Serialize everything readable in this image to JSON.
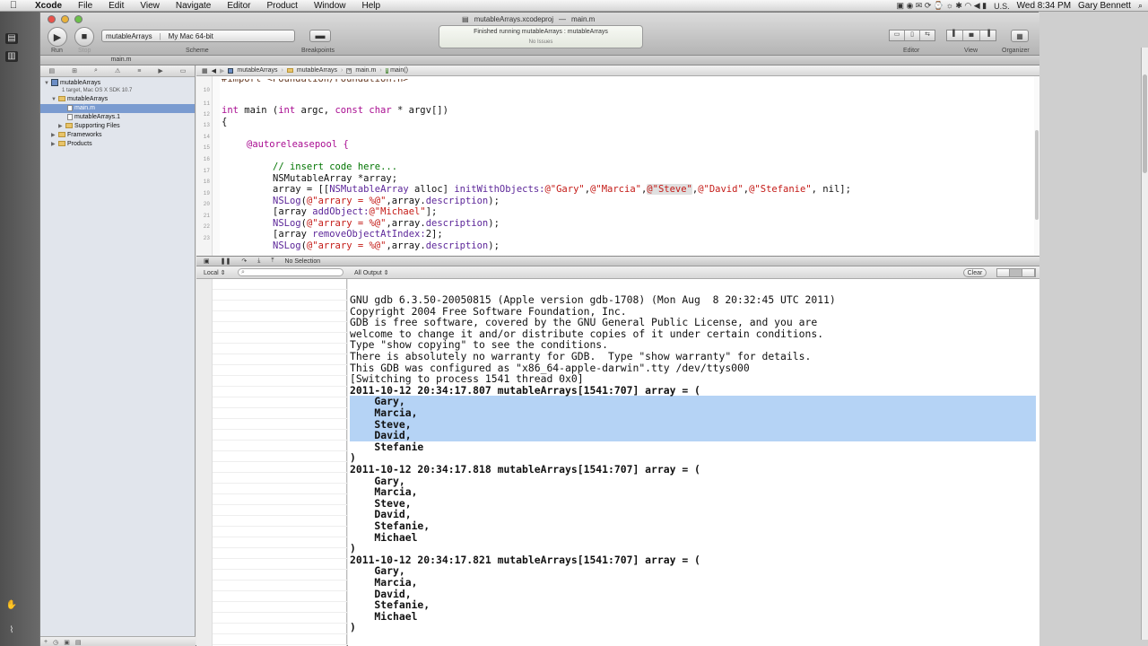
{
  "menubar": {
    "app": "Xcode",
    "items": [
      "File",
      "Edit",
      "View",
      "Navigate",
      "Editor",
      "Product",
      "Window",
      "Help"
    ],
    "locale": "U.S.",
    "clock": "Wed 8:34 PM",
    "user": "Gary Bennett"
  },
  "window": {
    "title_project": "mutableArrays.xcodeproj",
    "title_file": "main.m",
    "dash": "—"
  },
  "toolbar": {
    "run_label": "Run",
    "stop_label": "Stop",
    "scheme_name": "mutableArrays",
    "scheme_destination": "My Mac 64-bit",
    "scheme_label": "Scheme",
    "breakpoints_label": "Breakpoints",
    "activity_line1": "Finished running mutableArrays : mutableArrays",
    "activity_line2": "No Issues",
    "editor_label": "Editor",
    "view_label": "View",
    "organizer_label": "Organizer"
  },
  "tab": {
    "label": "main.m"
  },
  "navigator": {
    "project_name": "mutableArrays",
    "project_sub": "1 target, Mac OS X SDK 10.7",
    "group_name": "mutableArrays",
    "files": [
      "main.m",
      "mutableArrays.1"
    ],
    "supporting": "Supporting Files",
    "frameworks": "Frameworks",
    "products": "Products"
  },
  "jumpbar": {
    "crumbs": [
      "mutableArrays",
      "mutableArrays",
      "main.m",
      "main()"
    ]
  },
  "editor": {
    "line_numbers": [
      "10",
      "11",
      "12",
      "13",
      "14",
      "15",
      "16",
      "17",
      "18",
      "19",
      "20",
      "21",
      "22",
      "23"
    ],
    "code": {
      "import_partial": "#import <Foundation/Foundation.h>",
      "l11_a": "int",
      "l11_b": " main (",
      "l11_c": "int",
      "l11_d": " argc, ",
      "l11_e": "const",
      "l11_f": " ",
      "l11_g": "char",
      "l11_h": " * argv[])",
      "l12": "{",
      "l14": "@autoreleasepool {",
      "l16": "// insert code here...",
      "l17": "NSMutableArray *array;",
      "l18_a": "array = [[",
      "l18_b": "NSMutableArray",
      "l18_c": " alloc] ",
      "l18_d": "initWithObjects:",
      "l18_e": "@\"Gary\"",
      "l18_f": ",",
      "l18_g": "@\"Marcia\"",
      "l18_h": ",",
      "l18_i": "@\"Steve\"",
      "l18_j": ",",
      "l18_k": "@\"David\"",
      "l18_l": ",",
      "l18_m": "@\"Stefanie\"",
      "l18_n": ", nil];",
      "l19_a": "NSLog",
      "l19_b": "(",
      "l19_c": "@\"arrary = %@\"",
      "l19_d": ",array.",
      "l19_e": "description",
      "l19_f": ");",
      "l20_a": "[array ",
      "l20_b": "addObject:",
      "l20_c": "@\"Michael\"",
      "l20_d": "];",
      "l21_a": "NSLog",
      "l21_b": "(",
      "l21_c": "@\"arrary = %@\"",
      "l21_d": ",array.",
      "l21_e": "description",
      "l21_f": ");",
      "l22_a": "[array ",
      "l22_b": "removeObjectAtIndex:",
      "l22_c": "2];",
      "l23_a": "NSLog",
      "l23_b": "(",
      "l23_c": "@\"arrary = %@\"",
      "l23_d": ",array.",
      "l23_e": "description",
      "l23_f": ");"
    }
  },
  "debugbar": {
    "selection": "No Selection"
  },
  "filterbar": {
    "locals": "Local ⇕",
    "output": "All Output ⇕",
    "clear": "Clear"
  },
  "console": {
    "lines": [
      "GNU gdb 6.3.50-20050815 (Apple version gdb-1708) (Mon Aug  8 20:32:45 UTC 2011)",
      "Copyright 2004 Free Software Foundation, Inc.",
      "GDB is free software, covered by the GNU General Public License, and you are",
      "welcome to change it and/or distribute copies of it under certain conditions.",
      "Type \"show copying\" to see the conditions.",
      "There is absolutely no warranty for GDB.  Type \"show warranty\" for details.",
      "This GDB was configured as \"x86_64-apple-darwin\".tty /dev/ttys000",
      "[Switching to process 1541 thread 0x0]",
      "2011-10-12 20:34:17.807 mutableArrays[1541:707] array = (",
      "    Gary,",
      "    Marcia,",
      "    Steve,",
      "    David,",
      "    Stefanie",
      ")",
      "2011-10-12 20:34:17.818 mutableArrays[1541:707] array = (",
      "    Gary,",
      "    Marcia,",
      "    Steve,",
      "    David,",
      "    Stefanie,",
      "    Michael",
      ")",
      "2011-10-12 20:34:17.821 mutableArrays[1541:707] array = (",
      "    Gary,",
      "    Marcia,",
      "    David,",
      "    Stefanie,",
      "    Michael",
      ")"
    ]
  },
  "colors": {
    "selection": "#b5d3f5",
    "keyword": "#a90d91",
    "string": "#c41a16",
    "comment": "#007400",
    "class": "#5c2699"
  }
}
